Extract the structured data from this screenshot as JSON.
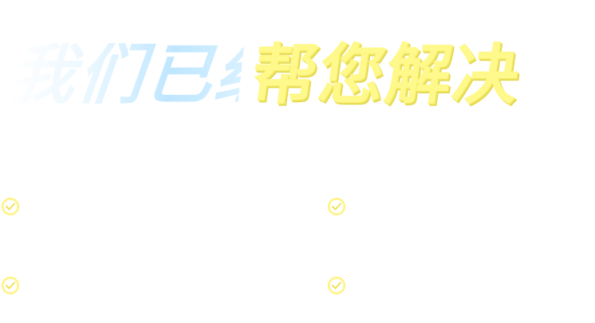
{
  "headline": {
    "left": "我们已经",
    "right": "帮您解决"
  },
  "features": [
    {
      "text": "",
      "icon": "check-circle-icon"
    },
    {
      "text": "",
      "icon": "check-circle-icon"
    },
    {
      "text": "",
      "icon": "check-circle-icon"
    },
    {
      "text": "",
      "icon": "check-circle-icon"
    }
  ],
  "colors": {
    "accent_yellow": "#fff88a",
    "accent_blue": "#bfe6ff",
    "background": "#ffffff"
  }
}
